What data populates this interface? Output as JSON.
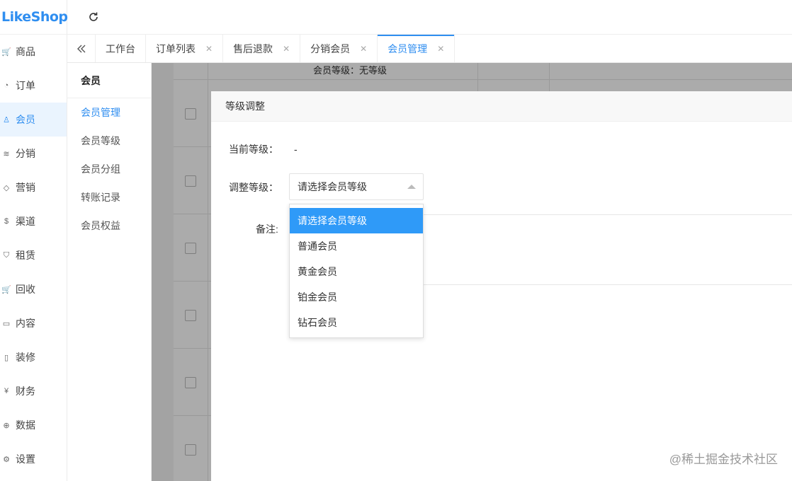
{
  "app": {
    "logo": "LikeShop"
  },
  "sidebar": {
    "items": [
      {
        "label": "商品",
        "icon": "cart-icon",
        "glyph": "🛒"
      },
      {
        "label": "订单",
        "icon": "bell-icon",
        "glyph": "◔"
      },
      {
        "label": "会员",
        "icon": "user-icon",
        "glyph": "♙"
      },
      {
        "label": "分销",
        "icon": "layers-icon",
        "glyph": "≋"
      },
      {
        "label": "营销",
        "icon": "diamond-icon",
        "glyph": "◇"
      },
      {
        "label": "渠道",
        "icon": "dollar-icon",
        "glyph": "$"
      },
      {
        "label": "租赁",
        "icon": "shield-icon",
        "glyph": "⛉"
      },
      {
        "label": "回收",
        "icon": "cart-icon",
        "glyph": "🛒"
      },
      {
        "label": "内容",
        "icon": "book-icon",
        "glyph": "▭"
      },
      {
        "label": "装修",
        "icon": "phone-icon",
        "glyph": "▯"
      },
      {
        "label": "财务",
        "icon": "yen-icon",
        "glyph": "¥"
      },
      {
        "label": "数据",
        "icon": "globe-icon",
        "glyph": "⊕"
      },
      {
        "label": "设置",
        "icon": "gear-icon",
        "glyph": "⚙"
      }
    ],
    "active_index": 2
  },
  "tabs": [
    {
      "label": "工作台",
      "closable": false
    },
    {
      "label": "订单列表",
      "closable": true
    },
    {
      "label": "售后退款",
      "closable": true
    },
    {
      "label": "分销会员",
      "closable": true
    },
    {
      "label": "会员管理",
      "closable": true
    }
  ],
  "tab_close_glyph": "✕",
  "subnav": {
    "title": "会员",
    "items": [
      "会员管理",
      "会员等级",
      "会员分组",
      "转账记录",
      "会员权益"
    ]
  },
  "background": {
    "level_text": "会员等级：无等级"
  },
  "dialog": {
    "title": "等级调整",
    "current_level_label": "当前等级：",
    "current_level_value": "-",
    "adjust_level_label": "调整等级：",
    "select_value": "请选择会员等级",
    "remark_label": "备注:",
    "options": [
      "请选择会员等级",
      "普通会员",
      "黄金会员",
      "铂金会员",
      "钻石会员"
    ]
  },
  "watermark": "@稀土掘金技术社区",
  "colors": {
    "accent": "#2f8ef0",
    "selected_option": "#2f9af8"
  }
}
